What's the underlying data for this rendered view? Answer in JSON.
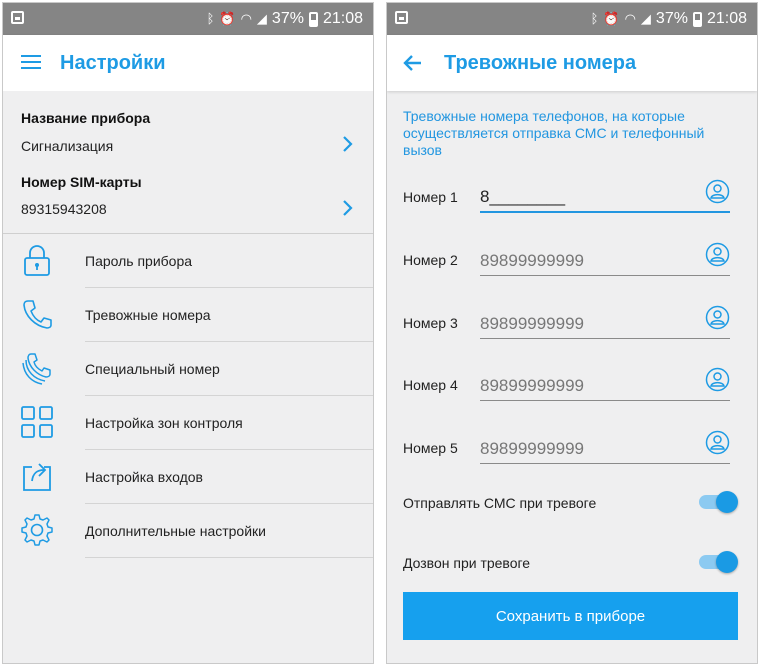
{
  "status_bar": {
    "battery": "37%",
    "time": "21:08"
  },
  "settings_screen": {
    "title": "Настройки",
    "device_name_label": "Название прибора",
    "device_name_value": "Сигнализация",
    "sim_label": "Номер SIM-карты",
    "sim_value": "89315943208",
    "menu": [
      {
        "label": "Пароль прибора",
        "icon": "lock-icon"
      },
      {
        "label": "Тревожные номера",
        "icon": "phone-icon"
      },
      {
        "label": "Специальный номер",
        "icon": "phone-double-icon"
      },
      {
        "label": "Настройка зон контроля",
        "icon": "grid-icon"
      },
      {
        "label": "Настройка входов",
        "icon": "input-icon"
      },
      {
        "label": "Дополнительные настройки",
        "icon": "gear-icon"
      }
    ]
  },
  "alarm_numbers_screen": {
    "title": "Тревожные номера",
    "description": "Тревожные номера телефонов, на которые осуществляется отправка СМС и телефонный вызов",
    "numbers": [
      {
        "label": "Номер 1",
        "value": "8________",
        "placeholder": ""
      },
      {
        "label": "Номер 2",
        "value": "",
        "placeholder": "89899999999"
      },
      {
        "label": "Номер 3",
        "value": "",
        "placeholder": "89899999999"
      },
      {
        "label": "Номер 4",
        "value": "",
        "placeholder": "89899999999"
      },
      {
        "label": "Номер 5",
        "value": "",
        "placeholder": "89899999999"
      }
    ],
    "toggles": [
      {
        "label": "Отправлять СМС при тревоге",
        "on": true
      },
      {
        "label": "Дозвон при тревоге",
        "on": true
      }
    ],
    "save_label": "Сохранить в приборе"
  },
  "colors": {
    "accent": "#1E9BE4",
    "status_bar": "#858585",
    "background": "#EFEFF0"
  }
}
